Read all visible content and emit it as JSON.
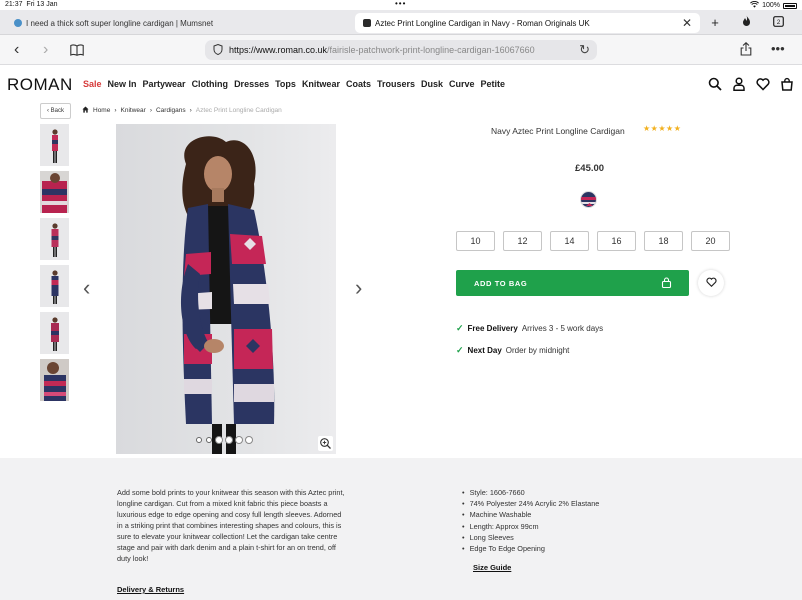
{
  "status_bar": {
    "time": "21:37",
    "date": "Fri 13 Jan",
    "battery": "100%"
  },
  "tabs": [
    {
      "title": "I need a thick soft super longline cardigan | Mumsnet",
      "active": false
    },
    {
      "title": "Aztec Print Longline Cardigan in Navy - Roman Originals UK",
      "active": true
    }
  ],
  "url": {
    "host": "https://www.roman.co.uk",
    "path": "/fairisle-patchwork-print-longline-cardigan-16067660"
  },
  "site": {
    "logo": "ROMAN",
    "nav": [
      "Sale",
      "New In",
      "Partywear",
      "Clothing",
      "Dresses",
      "Tops",
      "Knitwear",
      "Coats",
      "Trousers",
      "Dusk",
      "Curve",
      "Petite"
    ]
  },
  "back_label": "‹ Back",
  "breadcrumb": [
    "Home",
    "Knitwear",
    "Cardigans",
    "Aztec Print Longline Cardigan"
  ],
  "product": {
    "title": "Navy Aztec Print Longline Cardigan",
    "rating_stars": "★★★★★",
    "price": "£45.00",
    "sizes": [
      "10",
      "12",
      "14",
      "16",
      "18",
      "20"
    ],
    "add_to_bag": "ADD TO BAG",
    "delivery": [
      {
        "bold": "Free Delivery",
        "text": "Arrives 3 - 5 work days"
      },
      {
        "bold": "Next Day",
        "text": "Order by midnight"
      }
    ]
  },
  "description": "Add some bold prints to your knitwear this season with this Aztec print, longline cardigan. Cut from a mixed knit fabric this piece boasts a luxurious edge to edge opening and cosy full length sleeves. Adorned in a striking print that combines interesting shapes and colours, this is sure to elevate your knitwear collection! Let the cardigan take centre stage and pair with dark denim and a plain t-shirt for an on trend, off duty look!",
  "delivery_link": "Delivery & Returns",
  "specs": [
    "Style: 1606-7660",
    "74% Polyester 24% Acrylic 2% Elastane",
    "Machine Washable",
    "Length: Approx 99cm",
    "Long Sleeves",
    "Edge To Edge Opening"
  ],
  "size_guide": "Size Guide",
  "colors": {
    "brand_green": "#1fa14b",
    "sale_red": "#d63a3a",
    "star": "#f2b01e"
  }
}
